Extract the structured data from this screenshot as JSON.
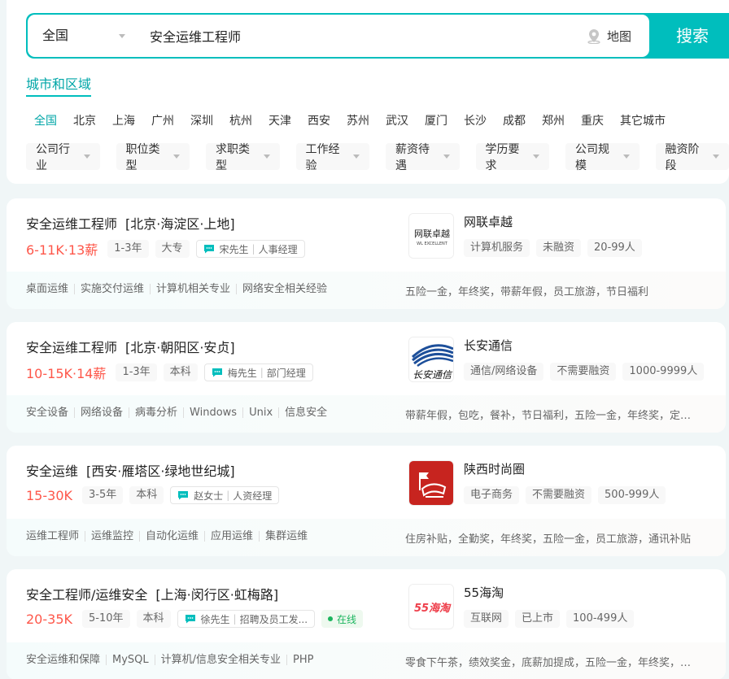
{
  "search": {
    "city": "全国",
    "query": "安全运维工程师",
    "map_label": "地图",
    "button_label": "搜索"
  },
  "filters": {
    "city_tab": "城市和区域",
    "cities": [
      "全国",
      "北京",
      "上海",
      "广州",
      "深圳",
      "杭州",
      "天津",
      "西安",
      "苏州",
      "武汉",
      "厦门",
      "长沙",
      "成都",
      "郑州",
      "重庆",
      "其它城市"
    ],
    "conditions": [
      "公司行业",
      "职位类型",
      "求职类型",
      "工作经验",
      "薪资待遇",
      "学历要求",
      "公司规模",
      "融资阶段"
    ]
  },
  "jobs": [
    {
      "title": "安全运维工程师",
      "area": "[北京·海淀区·上地]",
      "salary": "6-11K·13薪",
      "experience": "1-3年",
      "education": "大专",
      "boss_name": "宋先生",
      "boss_title": "人事经理",
      "online": "",
      "skills": [
        "桌面运维",
        "实施交付运维",
        "计算机相关专业",
        "网络安全相关经验"
      ],
      "welfare": "五险一金，年终奖，带薪年假，员工旅游，节日福利",
      "company": {
        "name": "网联卓越",
        "logo_text_cn": "网联卓越",
        "logo_text_en": "WL EXCELLENT",
        "tags": [
          "计算机服务",
          "未融资",
          "20-99人"
        ]
      }
    },
    {
      "title": "安全运维工程师",
      "area": "[北京·朝阳区·安贞]",
      "salary": "10-15K·14薪",
      "experience": "1-3年",
      "education": "本科",
      "boss_name": "梅先生",
      "boss_title": "部门经理",
      "online": "",
      "skills": [
        "安全设备",
        "网络设备",
        "病毒分析",
        "Windows",
        "Unix",
        "信息安全"
      ],
      "welfare": "带薪年假，包吃，餐补，节日福利，五险一金，年终奖，定期体检",
      "company": {
        "name": "长安通信",
        "logo_text_cn": "长安通信",
        "logo_text_en": "",
        "tags": [
          "通信/网络设备",
          "不需要融资",
          "1000-9999人"
        ]
      }
    },
    {
      "title": "安全运维",
      "area": "[西安·雁塔区·绿地世纪城]",
      "salary": "15-30K",
      "experience": "3-5年",
      "education": "本科",
      "boss_name": "赵女士",
      "boss_title": "人资经理",
      "online": "",
      "skills": [
        "运维工程师",
        "运维监控",
        "自动化运维",
        "应用运维",
        "集群运维"
      ],
      "welfare": "住房补贴，全勤奖，年终奖，五险一金，员工旅游，通讯补贴",
      "company": {
        "name": "陕西时尚圈",
        "logo_text_cn": "",
        "logo_text_en": "",
        "tags": [
          "电子商务",
          "不需要融资",
          "500-999人"
        ]
      }
    },
    {
      "title": "安全工程师/运维安全",
      "area": "[上海·闵行区·虹梅路]",
      "salary": "20-35K",
      "experience": "5-10年",
      "education": "本科",
      "boss_name": "徐先生",
      "boss_title": "招聘及员工发...",
      "online": "在线",
      "skills": [
        "安全运维和保障",
        "MySQL",
        "计算机/信息安全相关专业",
        "PHP"
      ],
      "welfare": "零食下午茶，绩效奖金，底薪加提成，五险一金，年终奖，带薪年假",
      "company": {
        "name": "55海淘",
        "logo_text_cn": "55海淘",
        "logo_text_en": "",
        "tags": [
          "互联网",
          "已上市",
          "100-499人"
        ]
      }
    }
  ],
  "colors": {
    "accent": "#00bebd",
    "accent_text": "#00a6a7",
    "salary": "#fe574a",
    "online": "#1bb55e"
  }
}
